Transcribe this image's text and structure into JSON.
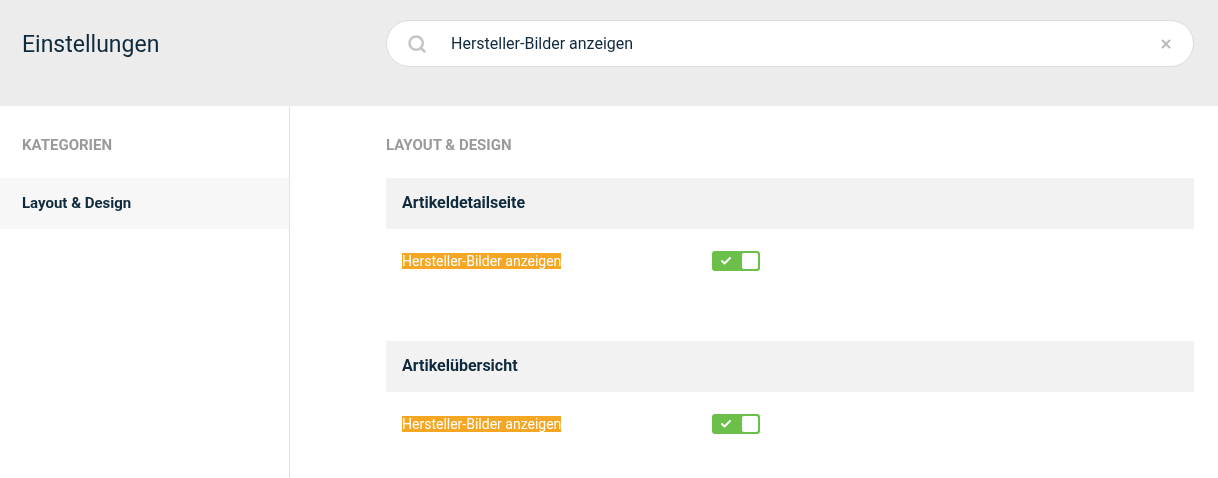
{
  "header": {
    "title": "Einstellungen",
    "search": {
      "value": "Hersteller-Bilder anzeigen"
    }
  },
  "sidebar": {
    "heading": "KATEGORIEN",
    "items": [
      {
        "label": "Layout & Design",
        "selected": true
      }
    ]
  },
  "content": {
    "heading": "LAYOUT & DESIGN",
    "groups": [
      {
        "title": "Artikeldetailseite",
        "settings": [
          {
            "label": "Hersteller-Bilder anzeigen",
            "highlighted": true,
            "on": true
          }
        ]
      },
      {
        "title": "Artikelübersicht",
        "settings": [
          {
            "label": "Hersteller-Bilder anzeigen",
            "highlighted": true,
            "on": true
          }
        ]
      }
    ]
  }
}
